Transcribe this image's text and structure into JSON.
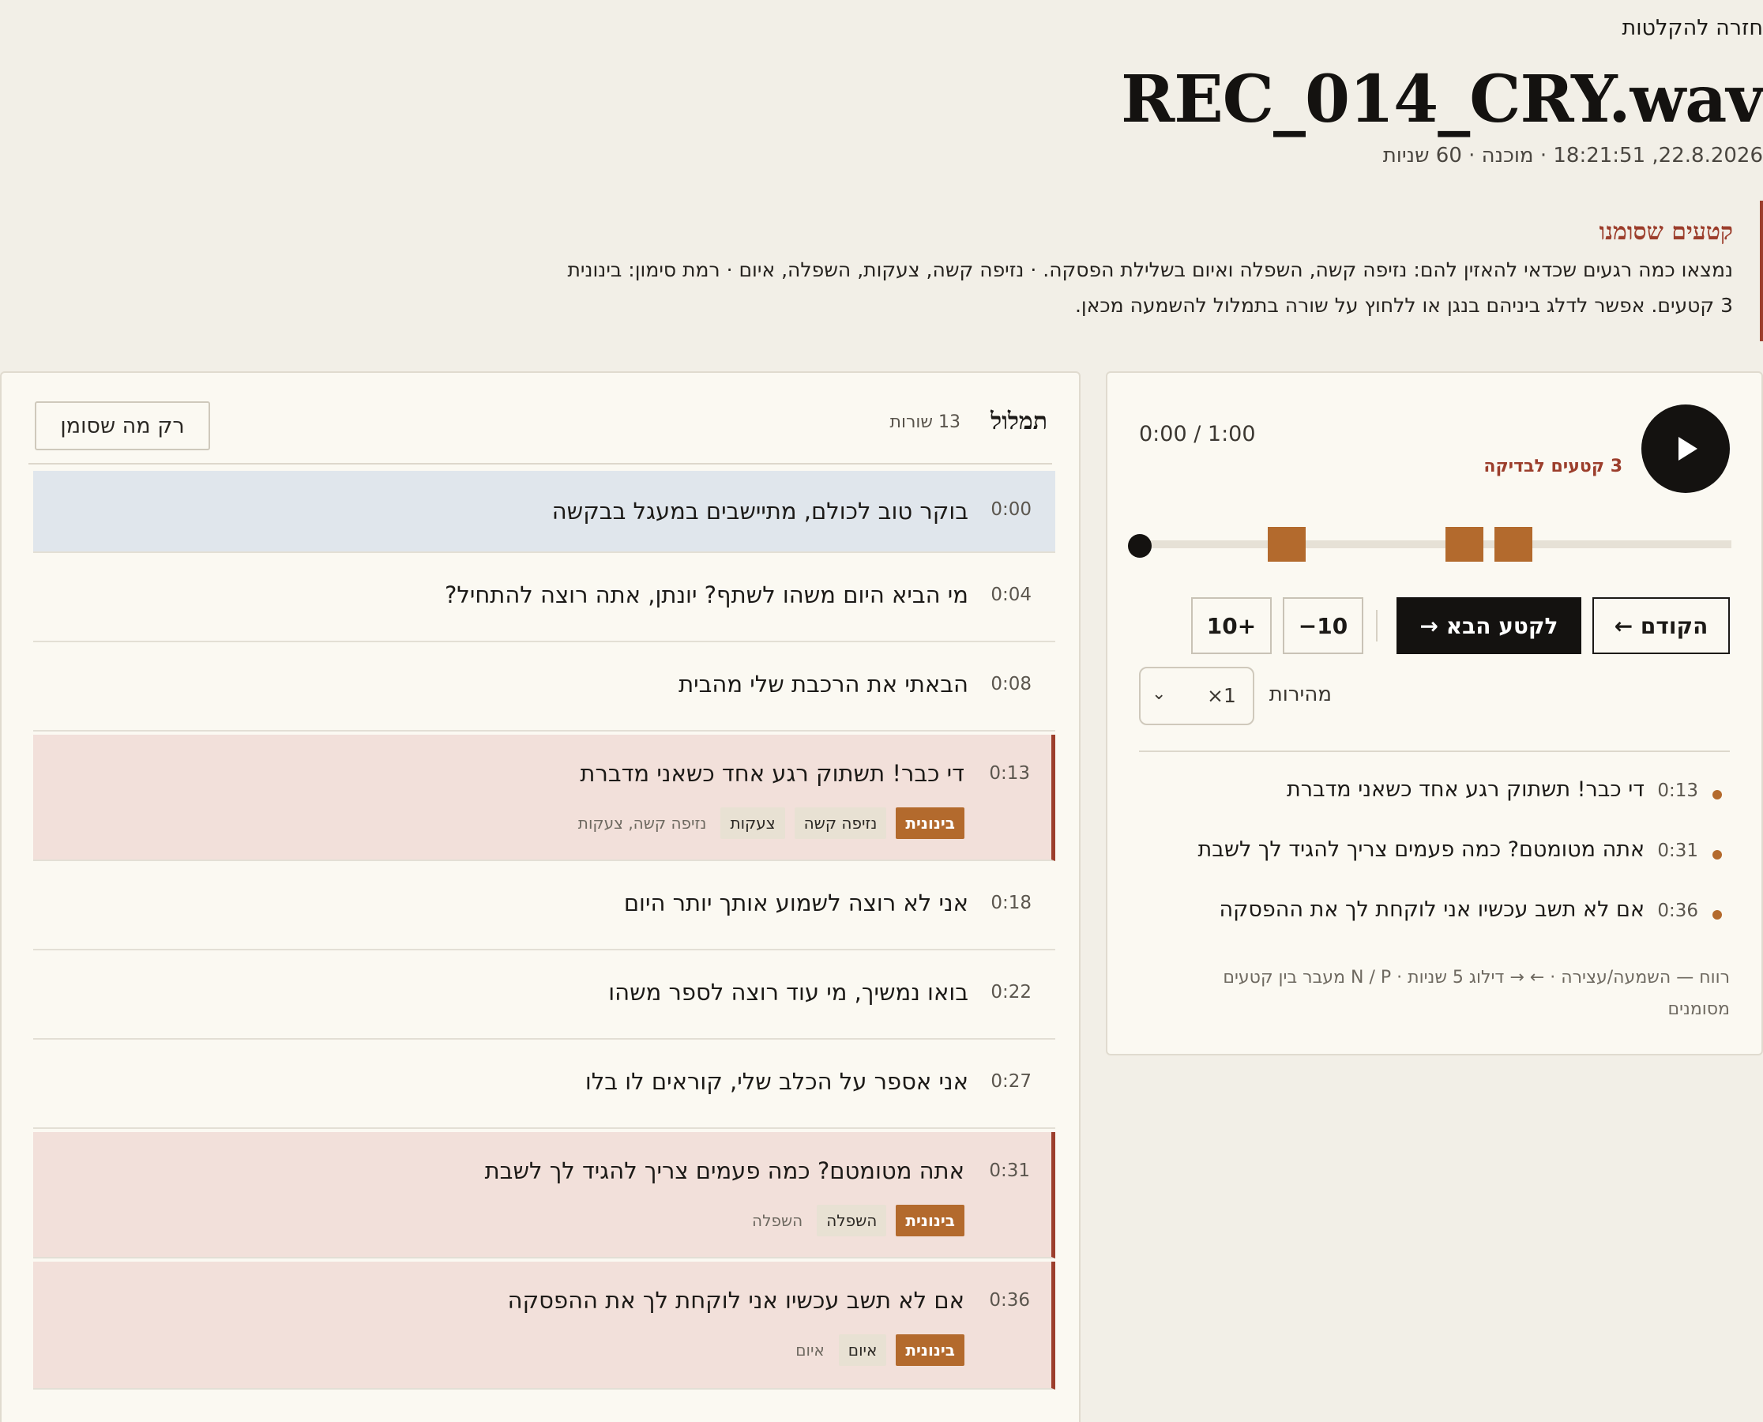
{
  "nav": {
    "back_label": "חזרה להקלטות"
  },
  "recording": {
    "filename": "REC_014_CRY.wav",
    "meta": "22.8.2026, 18:21:51 · מוכנה · 60 שניות"
  },
  "notice": {
    "title": "קטעים שסומנו",
    "line1": "נמצאו כמה רגעים שכדאי להאזין להם: נזיפה קשה, השפלה ואיום בשלילת הפסקה. · נזיפה קשה, צעקות, השפלה, איום · רמת סימון: בינונית",
    "line2": "3 קטעים. אפשר לדלג ביניהם בנגן או ללחוץ על שורה בתמלול להשמעה מכאן."
  },
  "transcript": {
    "title": "תמלול",
    "count": "13 שורות",
    "filter_label": "רק מה שסומן",
    "rows": [
      {
        "time": "0:00",
        "text": "בוקר טוב לכולם, מתיישבים במעגל בבקשה"
      },
      {
        "time": "0:04",
        "text": "מי הביא היום משהו לשתף? יונתן, אתה רוצה להתחיל?"
      },
      {
        "time": "0:08",
        "text": "הבאתי את הרכבת שלי מהבית"
      },
      {
        "time": "0:13",
        "text": "די כבר! תשתוק רגע אחד כשאני מדברת",
        "level": "בינונית",
        "tags": [
          "נזיפה קשה",
          "צעקות"
        ],
        "note": "נזיפה קשה, צעקות"
      },
      {
        "time": "0:18",
        "text": "אני לא רוצה לשמוע אותך יותר היום"
      },
      {
        "time": "0:22",
        "text": "בואו נמשיך, מי עוד רוצה לספר משהו"
      },
      {
        "time": "0:27",
        "text": "אני אספר על הכלב שלי, קוראים לו בלו"
      },
      {
        "time": "0:31",
        "text": "אתה מטומטם? כמה פעמים צריך להגיד לך לשבת",
        "level": "בינונית",
        "tags": [
          "השפלה"
        ],
        "note": "השפלה"
      },
      {
        "time": "0:36",
        "text": "אם לא תשב עכשיו אני לוקחת לך את ההפסקה",
        "level": "בינונית",
        "tags": [
          "איום"
        ],
        "note": "איום"
      }
    ]
  },
  "player": {
    "play_label": "נגן",
    "time_readout": "0:00 / 1:00",
    "flagged_count": "3 קטעים לבדיקה",
    "progress": 0,
    "duration_seconds": 60,
    "segments": [
      {
        "start": 13,
        "end": 17
      },
      {
        "start": 31,
        "end": 35
      },
      {
        "start": 36,
        "end": 40
      }
    ],
    "prev_label": "הקודם ←",
    "next_label": "לקטע הבא →",
    "minus_label": "10−",
    "plus_label": "+10",
    "speed_label": "מהירות",
    "speed_value": "×1",
    "clips": [
      {
        "time": "0:13",
        "text": "די כבר! תשתוק רגע אחד כשאני מדברת"
      },
      {
        "time": "0:31",
        "text": "אתה מטומטם? כמה פעמים צריך להגיד לך לשבת"
      },
      {
        "time": "0:36",
        "text": "אם לא תשב עכשיו אני לוקחת לך את ההפסקה"
      }
    ],
    "hint": "רווח — השמעה/עצירה · ← → דילוג 5 שניות · N / P מעבר בין קטעים מסומנים"
  },
  "colors": {
    "accent_red": "#9c3e2c",
    "accent_orange": "#b36a2d",
    "active_row": "#e0e6ec",
    "flag_row": "#f2e0da"
  }
}
